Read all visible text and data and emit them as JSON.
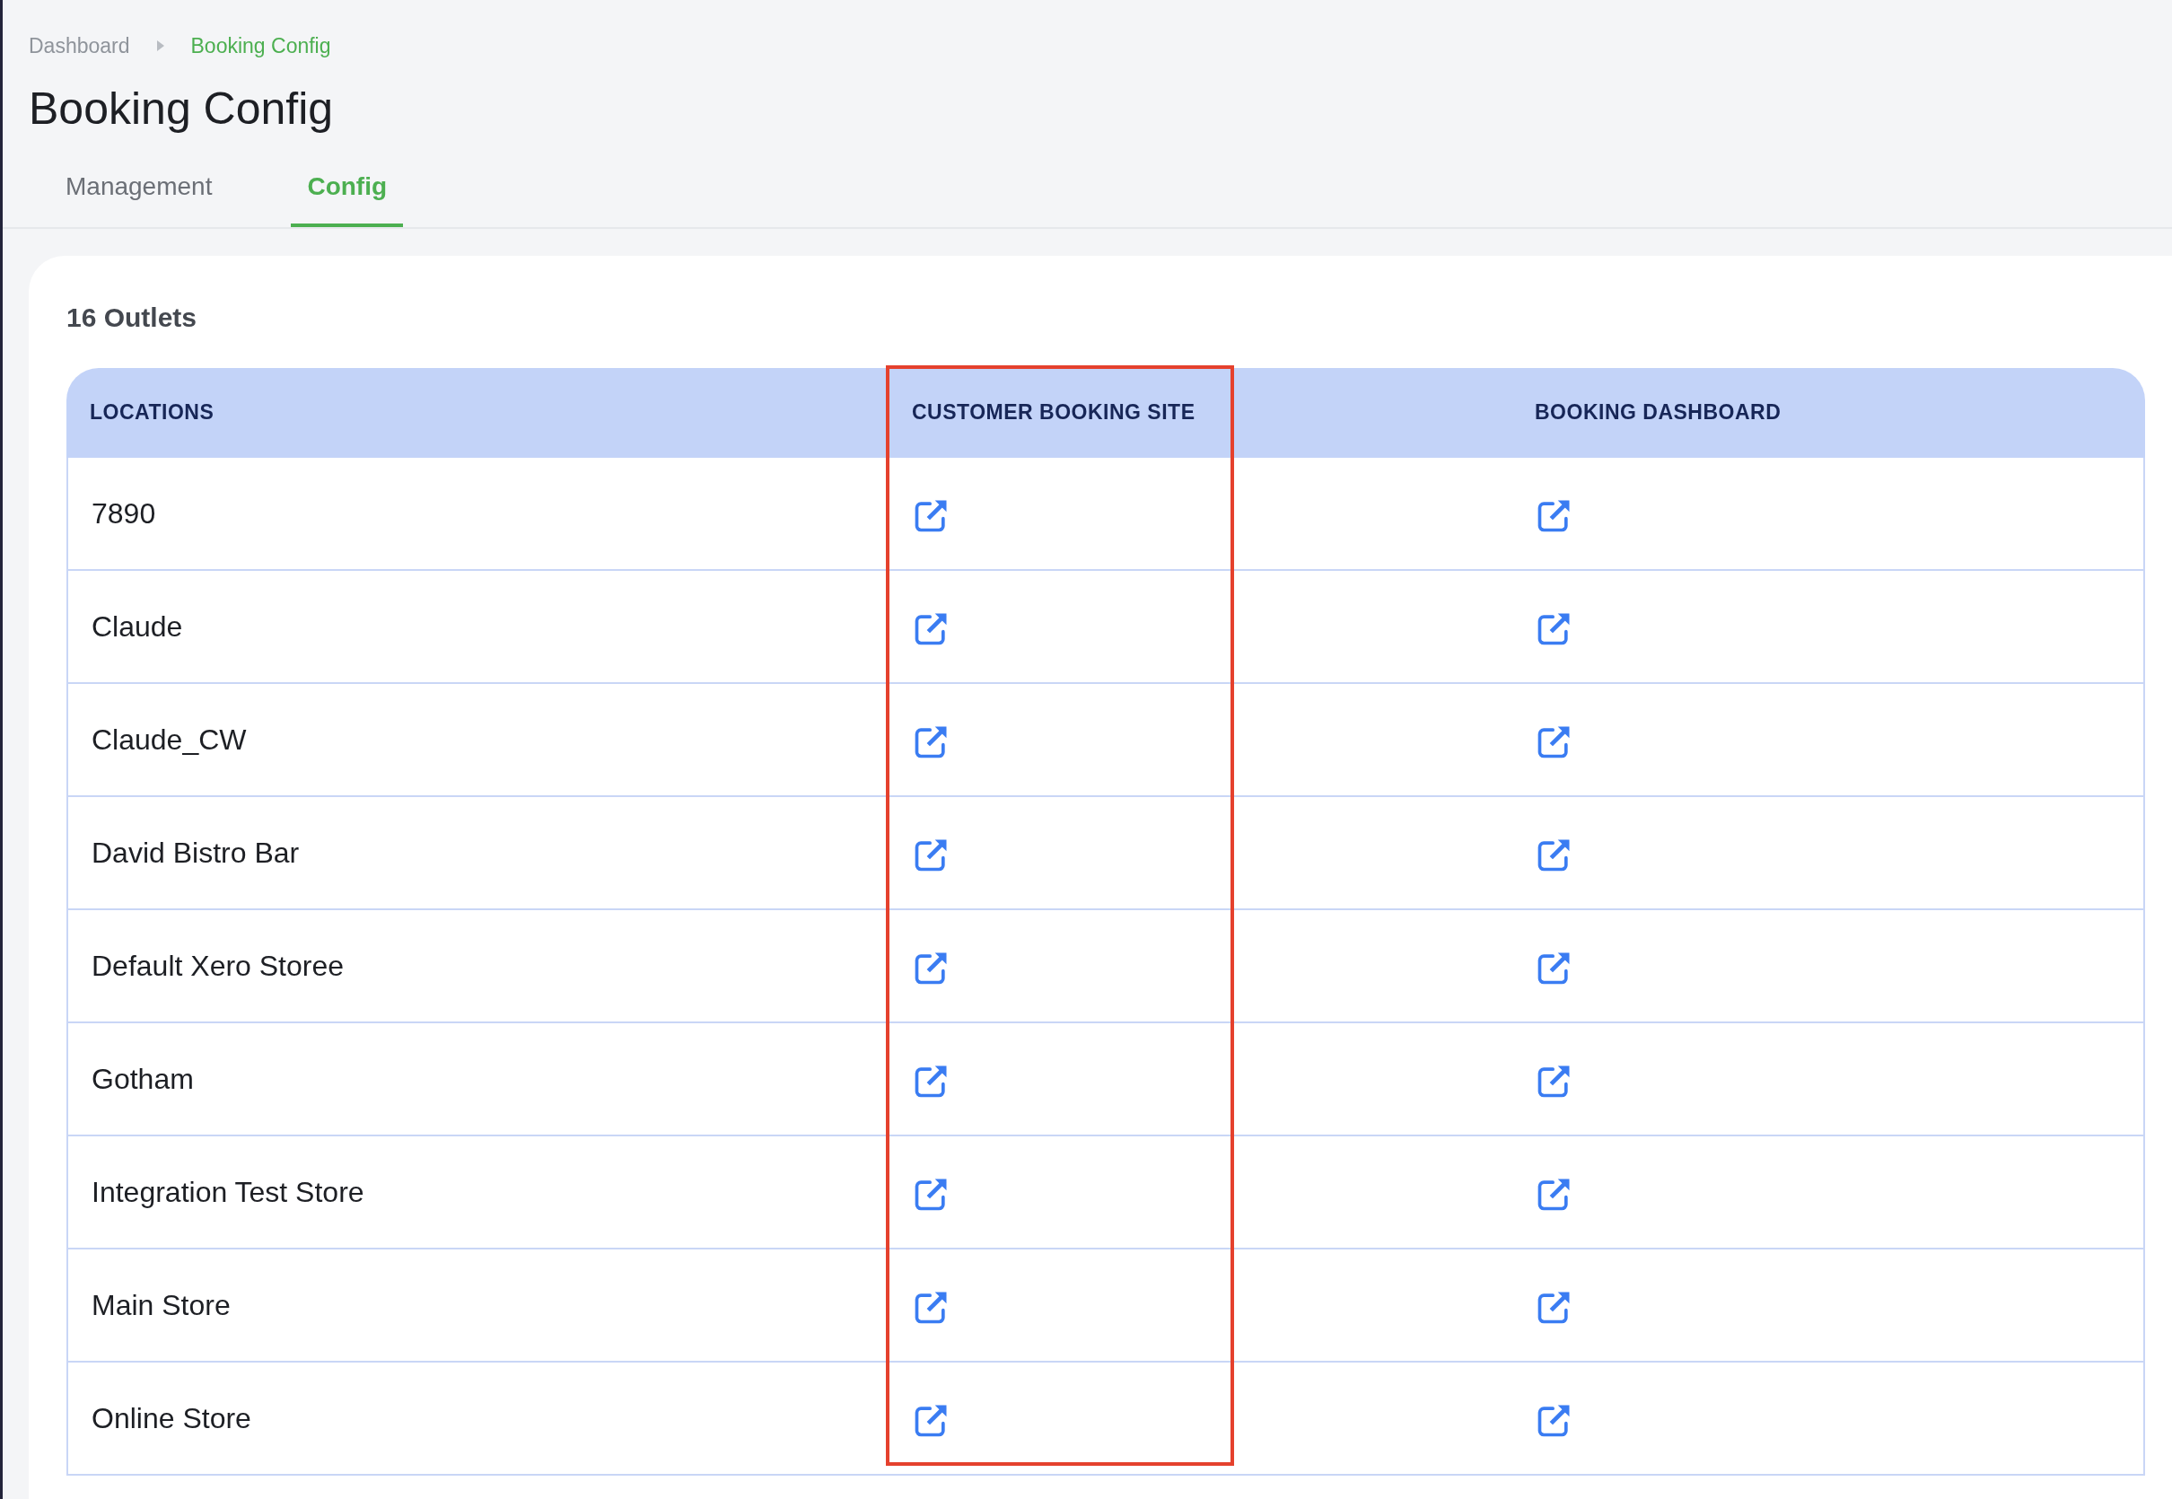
{
  "breadcrumb": [
    {
      "label": "Dashboard",
      "current": false
    },
    {
      "label": "Booking Config",
      "current": true
    }
  ],
  "title": "Booking Config",
  "tabs": [
    {
      "label": "Management",
      "selected": false
    },
    {
      "label": "Config",
      "selected": true
    }
  ],
  "outlets_title": "16 Outlets",
  "table": {
    "columns": [
      {
        "label": "LOCATIONS",
        "highlighted": false
      },
      {
        "label": "CUSTOMER BOOKING SITE",
        "highlighted": true
      },
      {
        "label": "BOOKING DASHBOARD",
        "highlighted": false
      }
    ],
    "rows": [
      {
        "location": "7890"
      },
      {
        "location": "Claude"
      },
      {
        "location": "Claude_CW"
      },
      {
        "location": "David Bistro Bar"
      },
      {
        "location": "Default Xero Storee"
      },
      {
        "location": "Gotham"
      },
      {
        "location": "Integration Test Store"
      },
      {
        "location": "Main Store"
      },
      {
        "location": "Online Store"
      }
    ]
  }
}
